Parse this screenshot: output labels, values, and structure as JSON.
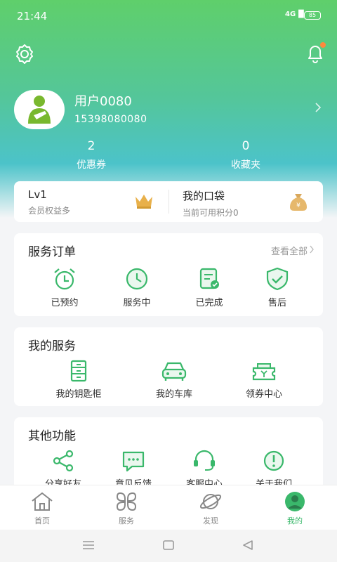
{
  "status_bar": {
    "time": "21:44",
    "signal": "4G",
    "battery": "85"
  },
  "header": {
    "settings_icon": "gear-icon",
    "notification_icon": "bell-icon"
  },
  "profile": {
    "username": "用户0080",
    "phone": "15398080080"
  },
  "stats": [
    {
      "value": "2",
      "label": "优惠券"
    },
    {
      "value": "0",
      "label": "收藏夹"
    }
  ],
  "wallet": {
    "level": "Lv1",
    "level_sub": "会员权益多",
    "pocket": "我的口袋",
    "pocket_sub": "当前可用积分0"
  },
  "orders": {
    "title": "服务订单",
    "more": "查看全部",
    "items": [
      {
        "label": "已预约",
        "icon": "alarm-clock-icon"
      },
      {
        "label": "服务中",
        "icon": "clock-icon"
      },
      {
        "label": "已完成",
        "icon": "document-check-icon"
      },
      {
        "label": "售后",
        "icon": "shield-check-icon"
      }
    ]
  },
  "services": {
    "title": "我的服务",
    "items": [
      {
        "label": "我的钥匙柜",
        "icon": "locker-icon"
      },
      {
        "label": "我的车库",
        "icon": "car-icon"
      },
      {
        "label": "领券中心",
        "icon": "coupon-icon"
      }
    ]
  },
  "other": {
    "title": "其他功能",
    "items": [
      {
        "label": "分享好友",
        "icon": "share-icon"
      },
      {
        "label": "意见反馈",
        "icon": "chat-icon"
      },
      {
        "label": "客服中心",
        "icon": "headset-icon"
      },
      {
        "label": "关于我们",
        "icon": "info-icon"
      }
    ]
  },
  "tabbar": [
    {
      "label": "首页",
      "icon": "home-icon"
    },
    {
      "label": "服务",
      "icon": "grid-icon"
    },
    {
      "label": "发现",
      "icon": "planet-icon"
    },
    {
      "label": "我的",
      "icon": "user-icon",
      "active": true
    }
  ],
  "colors": {
    "accent": "#3ab86b",
    "hero_top": "#5fcf6b",
    "hero_bottom": "#4cc3c9"
  }
}
